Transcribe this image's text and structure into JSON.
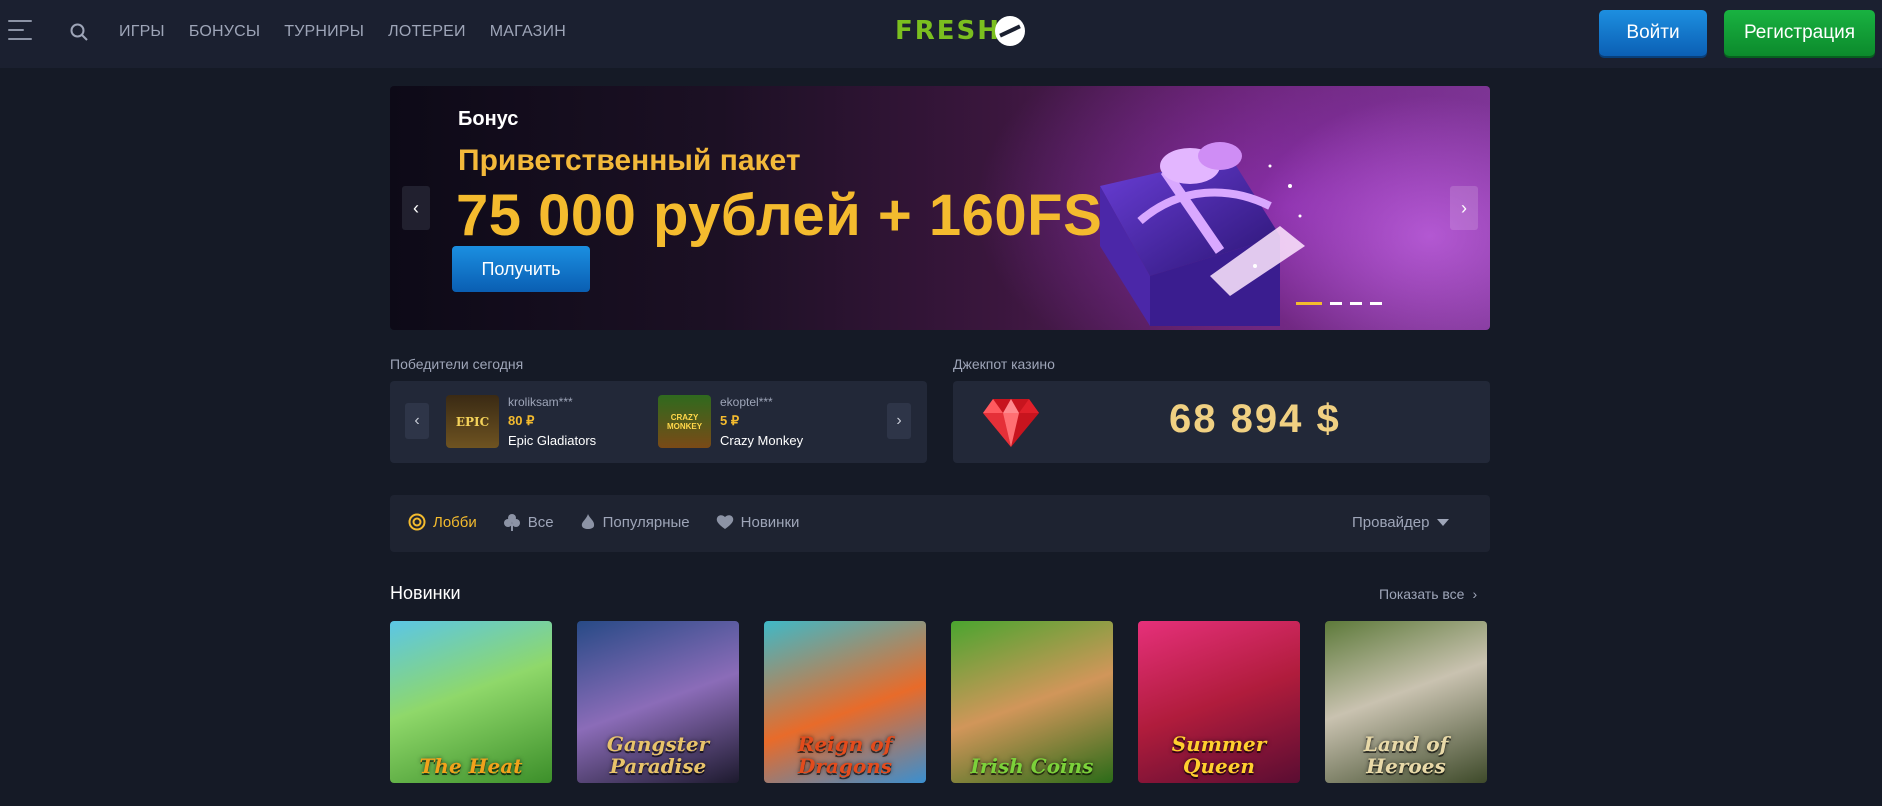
{
  "header": {
    "nav": [
      "ИГРЫ",
      "БОНУСЫ",
      "ТУРНИРЫ",
      "ЛОТЕРЕИ",
      "МАГАЗИН"
    ],
    "logo": "FRESH",
    "login_label": "Войти",
    "register_label": "Регистрация"
  },
  "banner": {
    "label": "Бонус",
    "subtitle": "Приветственный пакет",
    "amount": "75 000 рублей + 160FS",
    "button_label": "Получить",
    "slides_count": 4,
    "active_slide": 1
  },
  "winners": {
    "title": "Победители сегодня",
    "items": [
      {
        "user": "kroliksam***",
        "amount": "80 ₽",
        "game": "Epic Gladiators",
        "thumb_label": "EPIC"
      },
      {
        "user": "ekoptel***",
        "amount": "5 ₽",
        "game": "Crazy Monkey",
        "thumb_label": "CRAZY MONKEY"
      }
    ]
  },
  "jackpot": {
    "title": "Джекпот казино",
    "value": "68 894 $"
  },
  "categories": {
    "items": [
      {
        "label": "Лобби",
        "icon": "lobby-icon",
        "active": true
      },
      {
        "label": "Все",
        "icon": "clover-icon",
        "active": false
      },
      {
        "label": "Популярные",
        "icon": "fire-icon",
        "active": false
      },
      {
        "label": "Новинки",
        "icon": "heart-icon",
        "active": false
      }
    ],
    "provider_label": "Провайдер"
  },
  "new_games": {
    "title": "Новинки",
    "show_all": "Показать все",
    "games": [
      {
        "title": "The Heat",
        "color": "#f1a21b"
      },
      {
        "title": "Gangster Paradise",
        "color": "#e8c36a"
      },
      {
        "title": "Reign of Dragons",
        "color": "#e34b1c"
      },
      {
        "title": "Irish Coins",
        "color": "#7bd13a"
      },
      {
        "title": "Summer Queen",
        "color": "#ffcf2e"
      },
      {
        "title": "Land of Heroes",
        "color": "#e8d9a8"
      }
    ]
  },
  "colors": {
    "accent": "#f4bb2e",
    "login": "#1d8fe0",
    "register": "#19b241",
    "background": "#151a26"
  }
}
